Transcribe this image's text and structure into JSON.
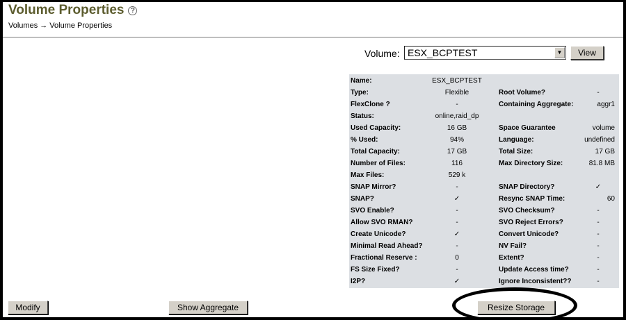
{
  "header": {
    "title": "Volume Properties",
    "help_icon": "?",
    "breadcrumb": "Volumes → Volume Properties"
  },
  "selector": {
    "label": "Volume:",
    "value": "ESX_BCPTEST",
    "arrow": "▼",
    "view_button": "View"
  },
  "properties": [
    {
      "k1": "Name:",
      "v1": "ESX_BCPTEST",
      "k2": "",
      "v2": ""
    },
    {
      "k1": "Type:",
      "v1": "Flexible",
      "k2": "Root Volume?",
      "v2": "-"
    },
    {
      "k1": "FlexClone ?",
      "v1": "-",
      "k2": "Containing Aggregate:",
      "v2": "aggr1"
    },
    {
      "k1": "Status:",
      "v1": "online,raid_dp",
      "k2": "",
      "v2": ""
    },
    {
      "k1": "Used Capacity:",
      "v1": "16 GB",
      "k2": "Space Guarantee",
      "v2": "volume"
    },
    {
      "k1": "% Used:",
      "v1": "94%",
      "k2": "Language:",
      "v2": "undefined"
    },
    {
      "k1": "Total Capacity:",
      "v1": "17 GB",
      "k2": "Total Size:",
      "v2": "17 GB"
    },
    {
      "k1": "Number of Files:",
      "v1": "116",
      "k2": "Max Directory Size:",
      "v2": "81.8 MB"
    },
    {
      "k1": "Max Files:",
      "v1": "529 k",
      "k2": "",
      "v2": ""
    },
    {
      "k1": "SNAP Mirror?",
      "v1": "-",
      "k2": "SNAP Directory?",
      "v2": "✓"
    },
    {
      "k1": "SNAP?",
      "v1": "✓",
      "k2": "Resync SNAP Time:",
      "v2": "60"
    },
    {
      "k1": "SVO Enable?",
      "v1": "-",
      "k2": "SVO Checksum?",
      "v2": "-"
    },
    {
      "k1": "Allow SVO RMAN?",
      "v1": "-",
      "k2": "SVO Reject Errors?",
      "v2": "-"
    },
    {
      "k1": "Create Unicode?",
      "v1": "✓",
      "k2": "Convert Unicode?",
      "v2": "-"
    },
    {
      "k1": "Minimal Read Ahead?",
      "v1": "-",
      "k2": "NV Fail?",
      "v2": "-"
    },
    {
      "k1": "Fractional Reserve :",
      "v1": "0",
      "k2": "Extent?",
      "v2": "-"
    },
    {
      "k1": "FS Size Fixed?",
      "v1": "-",
      "k2": "Update Access time?",
      "v2": "-"
    },
    {
      "k1": "I2P?",
      "v1": "✓",
      "k2": "Ignore Inconsistent??",
      "v2": "-"
    }
  ],
  "actions": {
    "modify": "Modify",
    "show_aggregate": "Show Aggregate",
    "resize_storage": "Resize Storage"
  }
}
